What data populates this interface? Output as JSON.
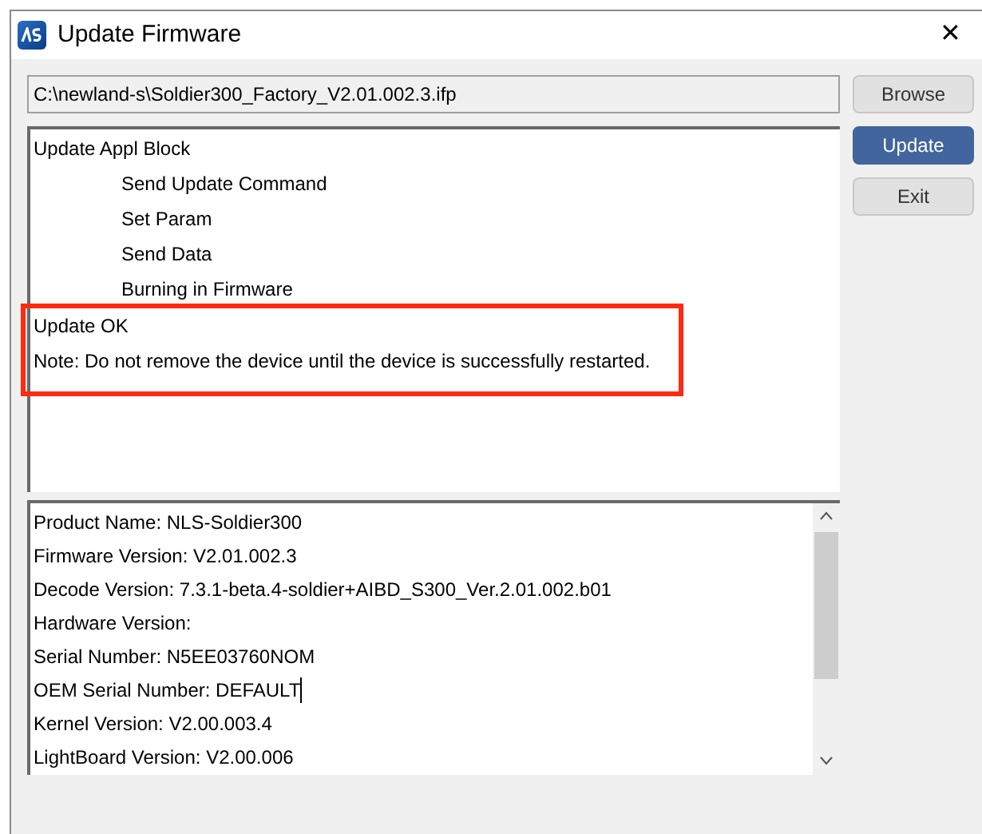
{
  "window": {
    "title": "Update Firmware",
    "close": "✕"
  },
  "file_path": {
    "value": "C:\\newland-s\\Soldier300_Factory_V2.01.002.3.ifp"
  },
  "buttons": [
    {
      "label": "Browse",
      "primary": false
    },
    {
      "label": "Update",
      "primary": true
    },
    {
      "label": "Exit",
      "primary": false
    }
  ],
  "log": [
    {
      "kind": "line",
      "text": "Update Appl Block",
      "children": [
        {
          "text": "Send Update Command"
        },
        {
          "text": "Set Param"
        },
        {
          "text": "Send Data"
        },
        {
          "text": "Burning in Firmware"
        }
      ]
    },
    {
      "kind": "highlight_frame",
      "lines": [
        {
          "text": "Update OK"
        },
        {
          "text": "Note: Do not remove the device until the device is successfully restarted."
        }
      ]
    }
  ],
  "device_info": [
    {
      "text": "Product Name: NLS-Soldier300",
      "cursor": false
    },
    {
      "text": "Firmware Version: V2.01.002.3",
      "cursor": false
    },
    {
      "text": "Decode Version: 7.3.1-beta.4-soldier+AIBD_S300_Ver.2.01.002.b01",
      "cursor": false
    },
    {
      "text": "Hardware Version:",
      "cursor": false
    },
    {
      "text": "Serial Number: N5EE03760NOM",
      "cursor": false
    },
    {
      "text": "OEM Serial Number: DEFAULT",
      "cursor": true
    },
    {
      "text": "Kernel Version: V2.00.003.4",
      "cursor": false
    },
    {
      "text": "LightBoard Version: V2.00.006",
      "cursor": false
    }
  ]
}
